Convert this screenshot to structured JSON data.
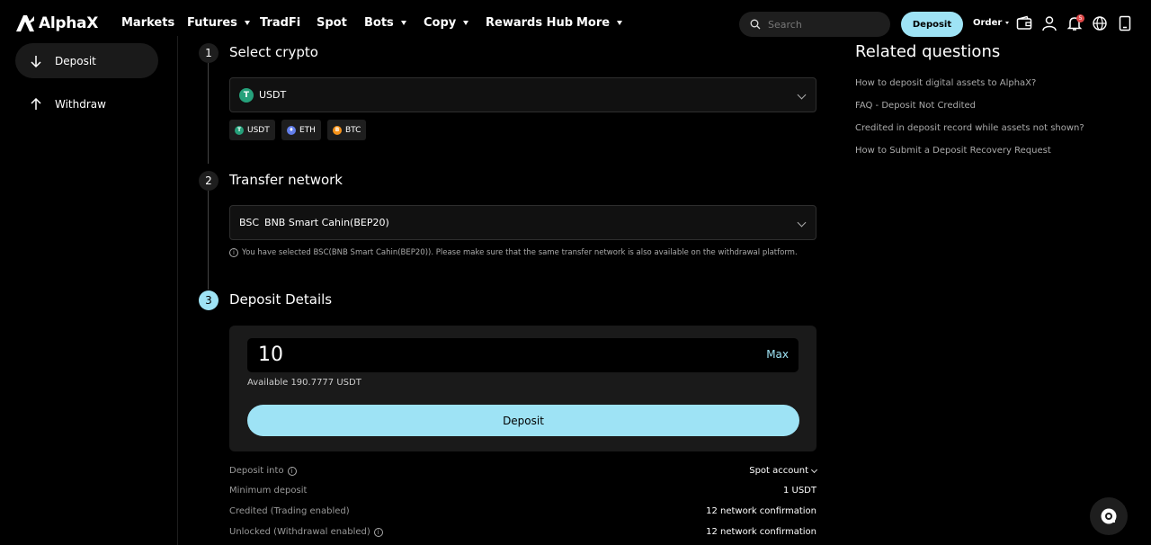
{
  "nav": {
    "logo": "AlphaX",
    "items": [
      {
        "label": "Markets",
        "dropdown": false
      },
      {
        "label": "Futures",
        "dropdown": true
      },
      {
        "label": "TradFi",
        "dropdown": false
      },
      {
        "label": "Spot",
        "dropdown": false
      },
      {
        "label": "Bots",
        "dropdown": true
      },
      {
        "label": "Copy",
        "dropdown": true
      },
      {
        "label": "Rewards Hub",
        "dropdown": false
      },
      {
        "label": "More",
        "dropdown": true
      }
    ],
    "search_placeholder": "Search",
    "deposit_label": "Deposit",
    "order_label": "Order",
    "notification_count": "5"
  },
  "sidebar": {
    "items": [
      {
        "label": "Deposit",
        "icon": "arrow-down-icon",
        "active": true
      },
      {
        "label": "Withdraw",
        "icon": "arrow-up-icon",
        "active": false
      }
    ]
  },
  "steps": [
    {
      "num": "1",
      "title": "Select crypto"
    },
    {
      "num": "2",
      "title": "Transfer network"
    },
    {
      "num": "3",
      "title": "Deposit Details"
    }
  ],
  "crypto": {
    "selected": "USDT",
    "quick_picks": [
      {
        "label": "USDT",
        "color": "#26a17b",
        "glyph": "T"
      },
      {
        "label": "ETH",
        "color": "#627eea",
        "glyph": "♦"
      },
      {
        "label": "BTC",
        "color": "#f7931a",
        "glyph": "B"
      }
    ]
  },
  "network": {
    "code": "BSC",
    "name": "BNB Smart Cahin(BEP20)",
    "note": "You have selected BSC(BNB Smart Cahin(BEP20)). Please make sure that the same transfer network is also available on the withdrawal platform."
  },
  "deposit": {
    "amount": "10",
    "max_label": "Max",
    "available": "Available 190.7777 USDT",
    "button_label": "Deposit"
  },
  "details": [
    {
      "label": "Deposit into",
      "value": "Spot account",
      "info": true,
      "dropdown": true
    },
    {
      "label": "Minimum deposit",
      "value": "1 USDT",
      "info": false,
      "dropdown": false
    },
    {
      "label": "Credited (Trading enabled)",
      "value": "12 network confirmation",
      "info": false,
      "dropdown": false
    },
    {
      "label": "Unlocked (Withdrawal enabled)",
      "value": "12 network confirmation",
      "info": true,
      "dropdown": false
    }
  ],
  "related": {
    "title": "Related questions",
    "links": [
      "How to deposit digital assets to AlphaX?",
      "FAQ - Deposit Not Credited",
      "Credited in deposit record while assets not shown?",
      "How to Submit a Deposit Recovery Request"
    ]
  },
  "colors": {
    "accent": "#9ee3f5",
    "usdt": "#26a17b"
  }
}
